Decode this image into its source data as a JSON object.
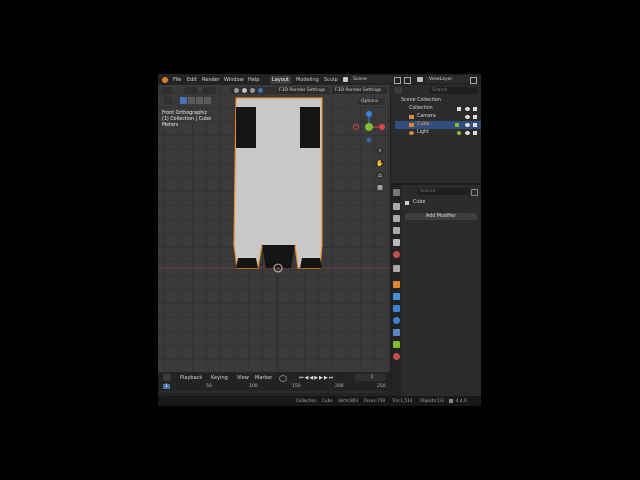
{
  "menu": {
    "file": "File",
    "edit": "Edit",
    "render": "Render",
    "window": "Window",
    "help": "Help"
  },
  "workspaces": {
    "layout": "Layout",
    "modeling": "Modeling",
    "sculpt": "Sculp"
  },
  "scene": {
    "scene": "Scene",
    "view_layer": "ViewLayer"
  },
  "viewport": {
    "render_settings_1": "F3D Render Settings",
    "render_settings_2": "F3D Render Settings",
    "options": "Options",
    "hud_view": "Front Orthographic",
    "hud_collection": "(1) Collection | Cube",
    "hud_units": "Meters"
  },
  "outliner": {
    "search_placeholder": "Search",
    "root": "Scene Collection",
    "collection": "Collection",
    "items": [
      "Camera",
      "Cube",
      "Light"
    ]
  },
  "properties": {
    "search_placeholder": "Search",
    "object_name": "Cube",
    "add_modifier": "Add Modifier"
  },
  "timeline": {
    "playback": "Playback",
    "keying": "Keying",
    "view": "View",
    "marker": "Marker",
    "current_frame": "1",
    "ticks": [
      "1",
      "50",
      "100",
      "150",
      "200",
      "250"
    ]
  },
  "status": {
    "collection": "Collection",
    "object": "Cube",
    "verts": "Verts:803",
    "faces": "Faces:759",
    "tris": "Tris:1,514",
    "objects": "Objects:1/3",
    "version": "4.4.0"
  },
  "colors": {
    "accent": "#4772b3",
    "selection_orange": "#f08c2a",
    "axis_x": "#e2414c",
    "axis_y": "#7fbf2d",
    "axis_z": "#3b82d6"
  }
}
